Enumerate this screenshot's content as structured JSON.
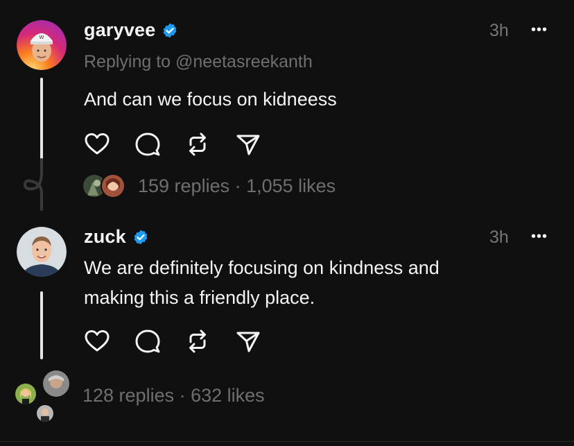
{
  "posts": [
    {
      "username": "garyvee",
      "time": "3h",
      "more": "•••",
      "reply_to": "Replying to @neetasreekanth",
      "text": "And can we focus on kidneess",
      "stats": "159 replies · 1,055 likes"
    },
    {
      "username": "zuck",
      "time": "3h",
      "more": "•••",
      "text_line1": "We are definitely focusing on kindness and",
      "text_line2": "making this a friendly place.",
      "stats": "128 replies · 632 likes"
    }
  ],
  "icons": {
    "verified": "verified-badge-icon",
    "like": "heart-icon",
    "reply": "comment-bubble-icon",
    "repost": "repost-icon",
    "share": "send-icon"
  },
  "colors": {
    "background": "#101010",
    "text": "#f3f5f7",
    "muted": "#6f6f6f",
    "verified": "#1d9bf0"
  }
}
